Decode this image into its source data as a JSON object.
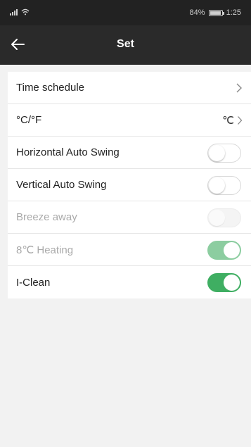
{
  "status_bar": {
    "battery": "84%",
    "time": "1:25",
    "icons": [
      "signal-icon",
      "wifi-icon",
      "battery-icon"
    ]
  },
  "header": {
    "title": "Set",
    "back_icon": "back-arrow-icon"
  },
  "settings": {
    "items": [
      {
        "label": "Time schedule",
        "control": "chevron"
      },
      {
        "label": "°C/°F",
        "control": "value-chevron",
        "value": "℃"
      },
      {
        "label": "Horizontal Auto Swing",
        "control": "toggle",
        "on": false,
        "enabled": true
      },
      {
        "label": "Vertical Auto Swing",
        "control": "toggle",
        "on": false,
        "enabled": true
      },
      {
        "label": "Breeze away",
        "control": "toggle",
        "on": false,
        "enabled": false
      },
      {
        "label": "8℃ Heating",
        "control": "toggle",
        "on": true,
        "enabled": false
      },
      {
        "label": "I-Clean",
        "control": "toggle",
        "on": true,
        "enabled": true
      }
    ]
  },
  "colors": {
    "header_bg": "#2a2a2a",
    "toggle_on": "#3fae62",
    "toggle_on_disabled": "#8ccda0",
    "page_bg": "#f2f2f2"
  }
}
